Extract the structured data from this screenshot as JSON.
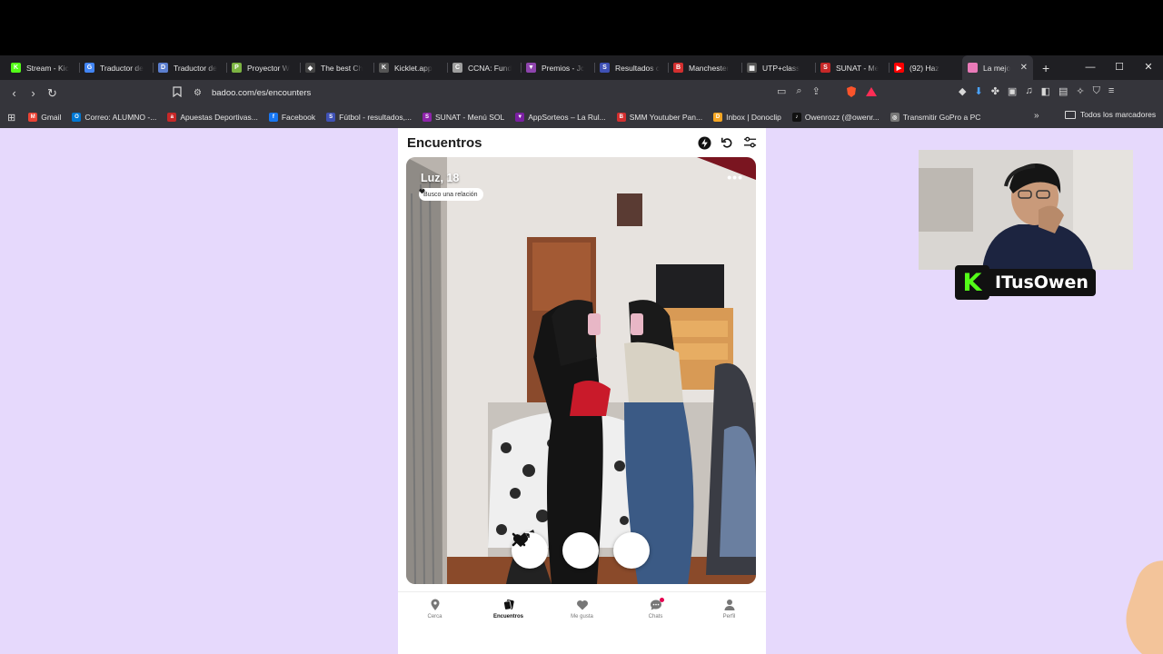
{
  "tabs": [
    {
      "label": "Stream - Kic",
      "color": "#53fc18",
      "glyph": "K"
    },
    {
      "label": "Traductor de",
      "color": "#4285f4",
      "glyph": "G"
    },
    {
      "label": "Traductor de",
      "color": "#5b7ecf",
      "glyph": "D"
    },
    {
      "label": "Proyector W",
      "color": "#7cb342",
      "glyph": "P"
    },
    {
      "label": "The best Ch",
      "color": "#444444",
      "glyph": "◆"
    },
    {
      "label": "Kicklet.app",
      "color": "#555555",
      "glyph": "K"
    },
    {
      "label": "CCNA: Fund",
      "color": "#9e9e9e",
      "glyph": "C"
    },
    {
      "label": "Premios - Jc",
      "color": "#8e44ad",
      "glyph": "▼"
    },
    {
      "label": "Resultados c",
      "color": "#3f51b5",
      "glyph": "S"
    },
    {
      "label": "Manchester",
      "color": "#d32f2f",
      "glyph": "B"
    },
    {
      "label": "UTP+class",
      "color": "#555555",
      "glyph": "▦"
    },
    {
      "label": "SUNAT - Me",
      "color": "#c62828",
      "glyph": "S"
    },
    {
      "label": "(92) Haz",
      "color": "#ff0000",
      "glyph": "▶"
    }
  ],
  "active_tab": {
    "label": "La mejo",
    "color": "#e97ab8"
  },
  "window_controls": [
    "—",
    "☐",
    "✕"
  ],
  "address": {
    "url": "badoo.com/es/encounters"
  },
  "bookmarks": [
    {
      "label": "Gmail",
      "color": "#ea4335",
      "glyph": "M"
    },
    {
      "label": "Correo: ALUMNO -...",
      "color": "#0078d4",
      "glyph": "O"
    },
    {
      "label": "Apuestas Deportivas...",
      "color": "#c62828",
      "glyph": "a"
    },
    {
      "label": "Facebook",
      "color": "#1877f2",
      "glyph": "f"
    },
    {
      "label": "Fútbol - resultados,...",
      "color": "#3f51b5",
      "glyph": "S"
    },
    {
      "label": "SUNAT - Menú SOL",
      "color": "#8e24aa",
      "glyph": "S"
    },
    {
      "label": "AppSorteos – La Rul...",
      "color": "#7b1fa2",
      "glyph": "▼"
    },
    {
      "label": "SMM Youtuber Pan...",
      "color": "#d32f2f",
      "glyph": "B"
    },
    {
      "label": "Inbox | Donoclip",
      "color": "#f5a623",
      "glyph": "D"
    },
    {
      "label": "Owenrozz (@owenr...",
      "color": "#111111",
      "glyph": "♪"
    },
    {
      "label": "Transmitir GoPro a PC",
      "color": "#777777",
      "glyph": "◎"
    }
  ],
  "bookmarks_all": "Todos los marcadores",
  "encounters": {
    "title": "Encuentros",
    "profile_name": "Luz, 18",
    "intent": "Busco una relación",
    "more": "•••"
  },
  "bottom_nav": {
    "items": [
      {
        "label": "Cerca",
        "icon": "location-pin-icon"
      },
      {
        "label": "Encuentros",
        "icon": "cards-icon"
      },
      {
        "label": "Me gusta",
        "icon": "heart-icon"
      },
      {
        "label": "Chats",
        "icon": "chat-icon"
      },
      {
        "label": "Perfil",
        "icon": "person-icon"
      }
    ]
  },
  "stream": {
    "streamer": "ITusOwen",
    "kick_glyph": "K"
  },
  "colors": {
    "page_bg": "#e6d9fc",
    "accent": "#e5004f",
    "kick_green": "#53fc18"
  }
}
